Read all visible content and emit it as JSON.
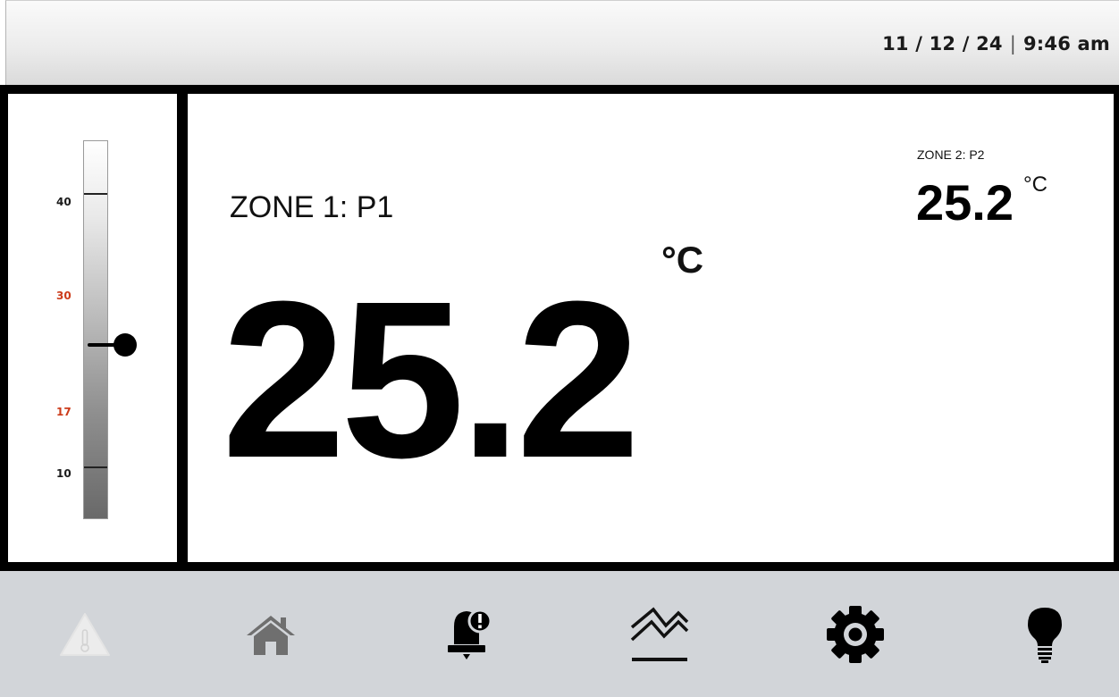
{
  "header": {
    "date": "11 / 12 / 24",
    "separator": "|",
    "time": "9:46 am"
  },
  "gauge": {
    "ticks": [
      {
        "label": "40",
        "color": "#1a1a1a"
      },
      {
        "label": "30",
        "color": "#cc3b1a"
      },
      {
        "label": "17",
        "color": "#cc3b1a"
      },
      {
        "label": "10",
        "color": "#1a1a1a"
      }
    ],
    "current_value": 25.2
  },
  "zone1": {
    "label": "ZONE 1: P1",
    "value": "25.2",
    "unit": "°C"
  },
  "zone2": {
    "label": "ZONE 2: P2",
    "value": "25.2",
    "unit": "°C"
  },
  "nav": {
    "items": [
      {
        "icon": "thermometer-warning-icon",
        "state": "disabled"
      },
      {
        "icon": "home-icon",
        "state": "normal"
      },
      {
        "icon": "alarm-bell-icon",
        "state": "normal"
      },
      {
        "icon": "trend-graph-icon",
        "state": "normal"
      },
      {
        "icon": "gear-icon",
        "state": "normal"
      },
      {
        "icon": "light-bulb-icon",
        "state": "normal"
      }
    ]
  },
  "colors": {
    "accent_red": "#cc3b1a",
    "nav_background": "#d2d5d9",
    "frame": "#000000"
  }
}
